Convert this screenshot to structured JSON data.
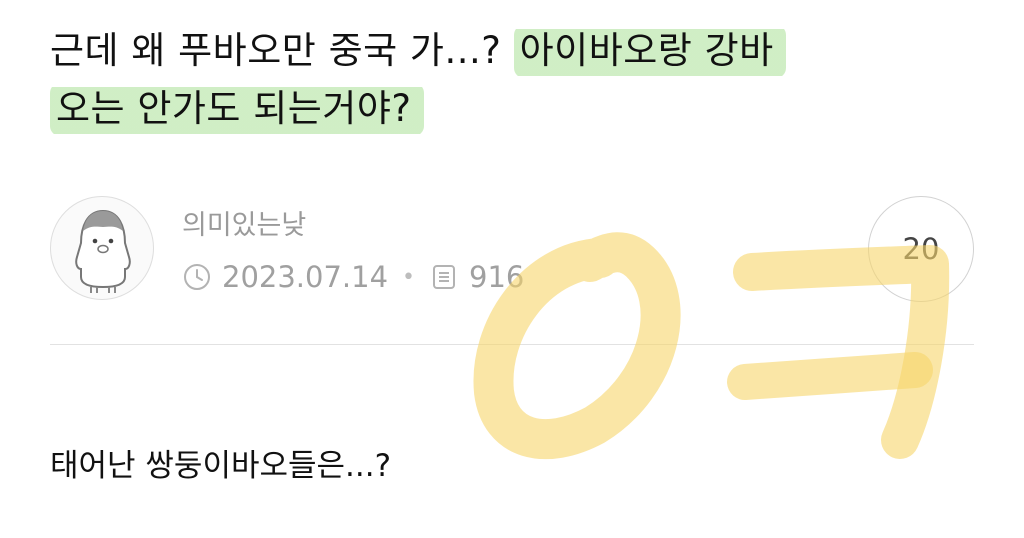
{
  "post": {
    "title_line1_plain": "근데 왜 푸바오만 중국 가...? ",
    "title_line1_highlight": "아이바오랑 강바",
    "title_line2_highlight": "오는 안가도 되는거야?",
    "author": "의미있는낮",
    "date": "2023.07.14",
    "views": "916",
    "comment_count": "20",
    "body": "태어난 쌍둥이바오들은...?"
  },
  "icons": {
    "avatar": "penguin-avatar-icon",
    "date": "clock-icon",
    "views": "document-icon"
  },
  "colors": {
    "highlight": "#aee196",
    "doodle": "#f6d76a",
    "meta_text": "#a0a0a0"
  }
}
